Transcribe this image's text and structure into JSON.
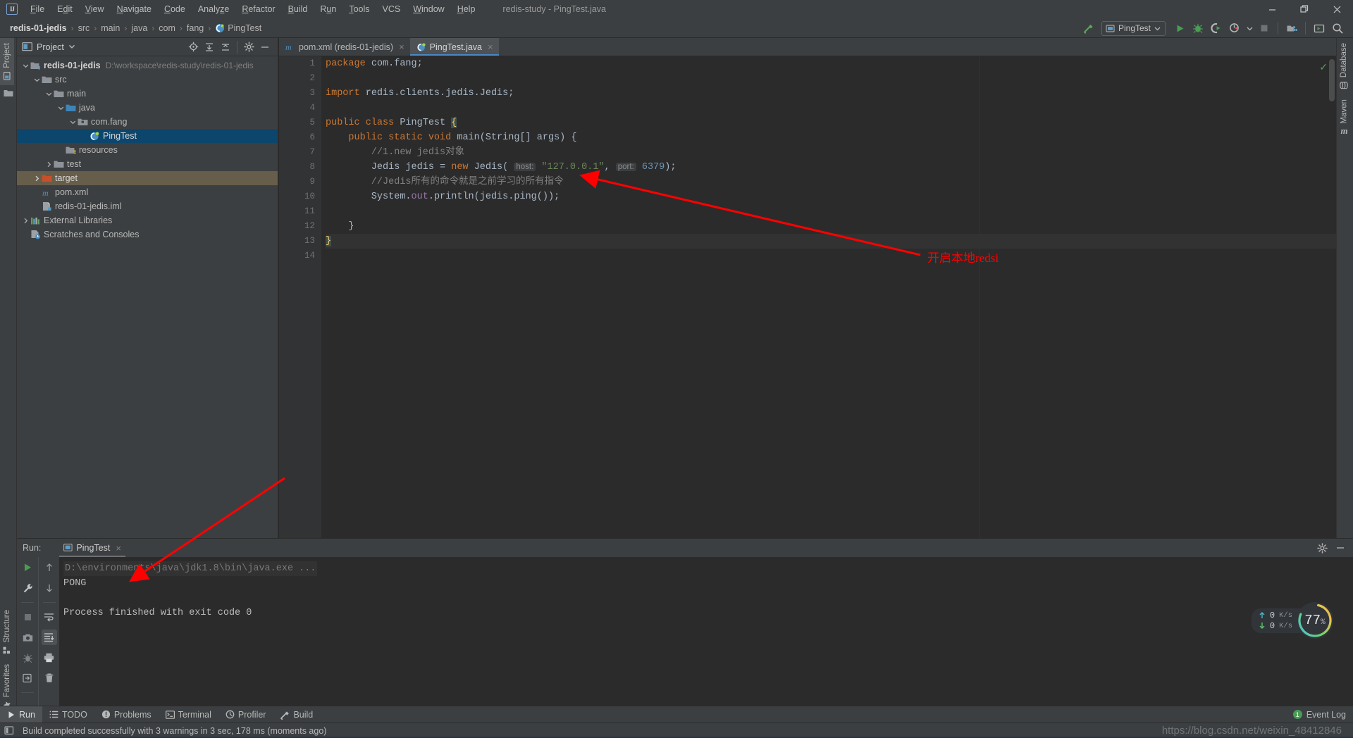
{
  "window": {
    "title": "redis-study - PingTest.java",
    "logo": "intellij-idea-logo",
    "minimize": "minimize-icon",
    "maximize": "maximize-icon",
    "close": "close-icon"
  },
  "menu": {
    "items": [
      {
        "label": "File"
      },
      {
        "label": "Edit"
      },
      {
        "label": "View"
      },
      {
        "label": "Navigate"
      },
      {
        "label": "Code"
      },
      {
        "label": "Analyze"
      },
      {
        "label": "Refactor"
      },
      {
        "label": "Build"
      },
      {
        "label": "Run"
      },
      {
        "label": "Tools"
      },
      {
        "label": "VCS"
      },
      {
        "label": "Window"
      },
      {
        "label": "Help"
      }
    ]
  },
  "breadcrumb": {
    "items": [
      "redis-01-jedis",
      "src",
      "main",
      "java",
      "com",
      "fang",
      "PingTest"
    ],
    "separator": "›"
  },
  "toolbar": {
    "build_hammer": "build-hammer-icon",
    "run_config": "PingTest",
    "run_config_chevron": "chevron-down-icon",
    "run": "run-icon",
    "debug": "debug-icon",
    "run_coverage": "run-with-coverage-icon",
    "profile": "profiler-icon",
    "profile_chevron": "chevron-down-icon",
    "stop": "stop-icon",
    "project_structure": "project-structure-icon",
    "select_target": "select-run-target-icon",
    "search": "search-icon"
  },
  "left_stripe": {
    "top": [
      {
        "label": "Project",
        "icon": "project-panel-icon",
        "active": true
      }
    ],
    "folder_icon": "folder-icon",
    "bottom": [
      {
        "label": "Structure",
        "icon": "structure-icon"
      },
      {
        "label": "Favorites",
        "icon": "star-icon"
      }
    ],
    "corner": "toggle-toolwindow-bars-icon"
  },
  "right_stripe": {
    "items": [
      {
        "label": "Database",
        "icon": "database-icon"
      },
      {
        "label": "Maven",
        "icon": "maven-icon"
      }
    ]
  },
  "project_panel": {
    "title": "Project",
    "title_icon": "project-view-icon",
    "chevron": "chevron-down-icon",
    "header_icons": [
      {
        "name": "locate-icon"
      },
      {
        "name": "expand-all-icon"
      },
      {
        "name": "collapse-all-icon"
      },
      {
        "name": "settings-gear-icon"
      },
      {
        "name": "hide-icon"
      }
    ],
    "tree": [
      {
        "label": "redis-01-jedis",
        "path": "D:\\workspace\\redis-study\\redis-01-jedis",
        "indent": 0,
        "twist": "down",
        "icon": "module-folder-icon",
        "bold": true,
        "state": "normal"
      },
      {
        "label": "src",
        "indent": 1,
        "twist": "down",
        "icon": "folder-icon",
        "state": "normal"
      },
      {
        "label": "main",
        "indent": 2,
        "twist": "down",
        "icon": "folder-icon",
        "state": "normal"
      },
      {
        "label": "java",
        "indent": 3,
        "twist": "down",
        "icon": "source-folder-icon",
        "state": "normal"
      },
      {
        "label": "com.fang",
        "indent": 4,
        "twist": "down",
        "icon": "package-icon",
        "state": "normal"
      },
      {
        "label": "PingTest",
        "indent": 5,
        "twist": "none",
        "icon": "java-class-icon",
        "state": "selected"
      },
      {
        "label": "resources",
        "indent": 3,
        "twist": "none",
        "icon": "resources-folder-icon",
        "state": "normal"
      },
      {
        "label": "test",
        "indent": 2,
        "twist": "right",
        "icon": "folder-icon",
        "state": "normal"
      },
      {
        "label": "target",
        "indent": 1,
        "twist": "right",
        "icon": "excluded-folder-icon",
        "state": "target"
      },
      {
        "label": "pom.xml",
        "indent": 1,
        "twist": "none",
        "icon": "maven-pom-icon",
        "state": "normal"
      },
      {
        "label": "redis-01-jedis.iml",
        "indent": 1,
        "twist": "none",
        "icon": "iml-file-icon",
        "state": "normal"
      },
      {
        "label": "External Libraries",
        "indent": 0,
        "twist": "right",
        "icon": "libraries-icon",
        "state": "normal"
      },
      {
        "label": "Scratches and Consoles",
        "indent": 0,
        "twist": "none",
        "icon": "scratches-icon",
        "state": "normal"
      }
    ]
  },
  "editor": {
    "tabs": [
      {
        "label": "pom.xml (redis-01-jedis)",
        "icon": "maven-pom-icon",
        "active": false,
        "close": "×"
      },
      {
        "label": "PingTest.java",
        "icon": "java-class-icon",
        "active": true,
        "close": "×"
      }
    ],
    "line_numbers": [
      "1",
      "2",
      "3",
      "4",
      "5",
      "6",
      "7",
      "8",
      "9",
      "10",
      "11",
      "12",
      "13",
      "14"
    ],
    "gutter_run_marks": [
      5,
      6
    ],
    "inspection_status": "✓",
    "lines": [
      {
        "n": 1,
        "tokens": [
          {
            "t": "package ",
            "c": "kw"
          },
          {
            "t": "com.fang",
            "c": "cls"
          },
          {
            "t": ";",
            "c": "cls"
          }
        ]
      },
      {
        "n": 2,
        "tokens": []
      },
      {
        "n": 3,
        "tokens": [
          {
            "t": "import ",
            "c": "kw"
          },
          {
            "t": "redis.clients.jedis.Jedis",
            "c": "cls"
          },
          {
            "t": ";",
            "c": "cls"
          }
        ]
      },
      {
        "n": 4,
        "tokens": []
      },
      {
        "n": 5,
        "tokens": [
          {
            "t": "public class ",
            "c": "kw"
          },
          {
            "t": "PingTest ",
            "c": "cls"
          },
          {
            "t": "{",
            "c": "brace-hl"
          }
        ]
      },
      {
        "n": 6,
        "tokens": [
          {
            "t": "    ",
            "c": "cls"
          },
          {
            "t": "public static void ",
            "c": "kw"
          },
          {
            "t": "main",
            "c": "cls"
          },
          {
            "t": "(String[] args) {",
            "c": "cls"
          }
        ]
      },
      {
        "n": 7,
        "tokens": [
          {
            "t": "        //1.new jedis对象",
            "c": "cmt"
          }
        ]
      },
      {
        "n": 8,
        "tokens": [
          {
            "t": "        Jedis jedis = ",
            "c": "cls"
          },
          {
            "t": "new ",
            "c": "kw"
          },
          {
            "t": "Jedis( ",
            "c": "cls"
          },
          {
            "t": "host:",
            "c": "hint"
          },
          {
            "t": " ",
            "c": "cls"
          },
          {
            "t": "\"127.0.0.1\"",
            "c": "str"
          },
          {
            "t": ", ",
            "c": "cls"
          },
          {
            "t": "port:",
            "c": "hint"
          },
          {
            "t": " ",
            "c": "cls"
          },
          {
            "t": "6379",
            "c": "num"
          },
          {
            "t": ");",
            "c": "cls"
          }
        ]
      },
      {
        "n": 9,
        "tokens": [
          {
            "t": "        //Jedis所有的命令就是之前学习的所有指令",
            "c": "cmt"
          }
        ]
      },
      {
        "n": 10,
        "tokens": [
          {
            "t": "        System.",
            "c": "cls"
          },
          {
            "t": "out",
            "c": "fld"
          },
          {
            "t": ".println(jedis.ping());",
            "c": "cls"
          }
        ]
      },
      {
        "n": 11,
        "tokens": []
      },
      {
        "n": 12,
        "tokens": [
          {
            "t": "    }",
            "c": "cls"
          }
        ]
      },
      {
        "n": 13,
        "tokens": [
          {
            "t": "}",
            "c": "brace-hl"
          }
        ],
        "caret": true
      },
      {
        "n": 14,
        "tokens": []
      }
    ],
    "annotation": {
      "text": "开启本地redsi",
      "color": "#ff0000",
      "arrow_color": "#ff0000"
    }
  },
  "run_panel": {
    "label": "Run:",
    "tab": {
      "label": "PingTest",
      "icon": "run-config-icon",
      "close": "×"
    },
    "header_icons": [
      {
        "name": "settings-gear-icon"
      },
      {
        "name": "hide-icon"
      }
    ],
    "left_tools": [
      {
        "name": "rerun-icon"
      },
      {
        "name": "edit-configuration-wrench-icon"
      },
      {
        "name": "stop-icon"
      },
      {
        "name": "screenshot-camera-icon"
      },
      {
        "name": "debug-disabled-icon"
      },
      {
        "name": "export-icon"
      }
    ],
    "right_tools": [
      {
        "name": "up-arrow-icon"
      },
      {
        "name": "down-arrow-icon"
      },
      {
        "name": "soft-wrap-icon"
      },
      {
        "name": "scroll-to-end-icon",
        "active": true
      },
      {
        "name": "print-icon"
      },
      {
        "name": "clear-all-trash-icon"
      }
    ],
    "console": [
      {
        "text": "D:\\environments\\java\\jdk1.8\\bin\\java.exe ...",
        "style": "cmd"
      },
      {
        "text": "PONG",
        "style": "out"
      },
      {
        "text": "",
        "style": "out"
      },
      {
        "text": "Process finished with exit code 0",
        "style": "out"
      }
    ],
    "monitor": {
      "upload": "0",
      "upload_unit": "K/s",
      "download": "0",
      "download_unit": "K/s",
      "cpu_percent": "77",
      "cpu_unit": "%",
      "upload_icon": "arrow-up-icon",
      "download_icon": "arrow-down-icon"
    }
  },
  "tool_window_bar": {
    "items": [
      {
        "label": "Run",
        "icon": "run-icon",
        "active": true
      },
      {
        "label": "TODO",
        "icon": "todo-list-icon",
        "active": false
      },
      {
        "label": "Problems",
        "icon": "problems-icon",
        "active": false
      },
      {
        "label": "Terminal",
        "icon": "terminal-icon",
        "active": false
      },
      {
        "label": "Profiler",
        "icon": "profiler-icon",
        "active": false
      },
      {
        "label": "Build",
        "icon": "build-hammer-icon",
        "active": false
      }
    ],
    "event_log": {
      "label": "Event Log",
      "badge": "1"
    }
  },
  "status_bar": {
    "icon": "status-square-icon",
    "message": "Build completed successfully with 3 warnings in 3 sec, 178 ms (moments ago)"
  },
  "watermark": {
    "text": "https://blog.csdn.net/weixin_48412846"
  },
  "colors": {
    "accent_blue": "#4a88c7",
    "selection_blue": "#0d466d",
    "target_brown": "#665d4a",
    "panel_bg": "#3c3f41",
    "editor_bg": "#2b2b2b",
    "annotation_red": "#ff0000",
    "green": "#499c54"
  }
}
